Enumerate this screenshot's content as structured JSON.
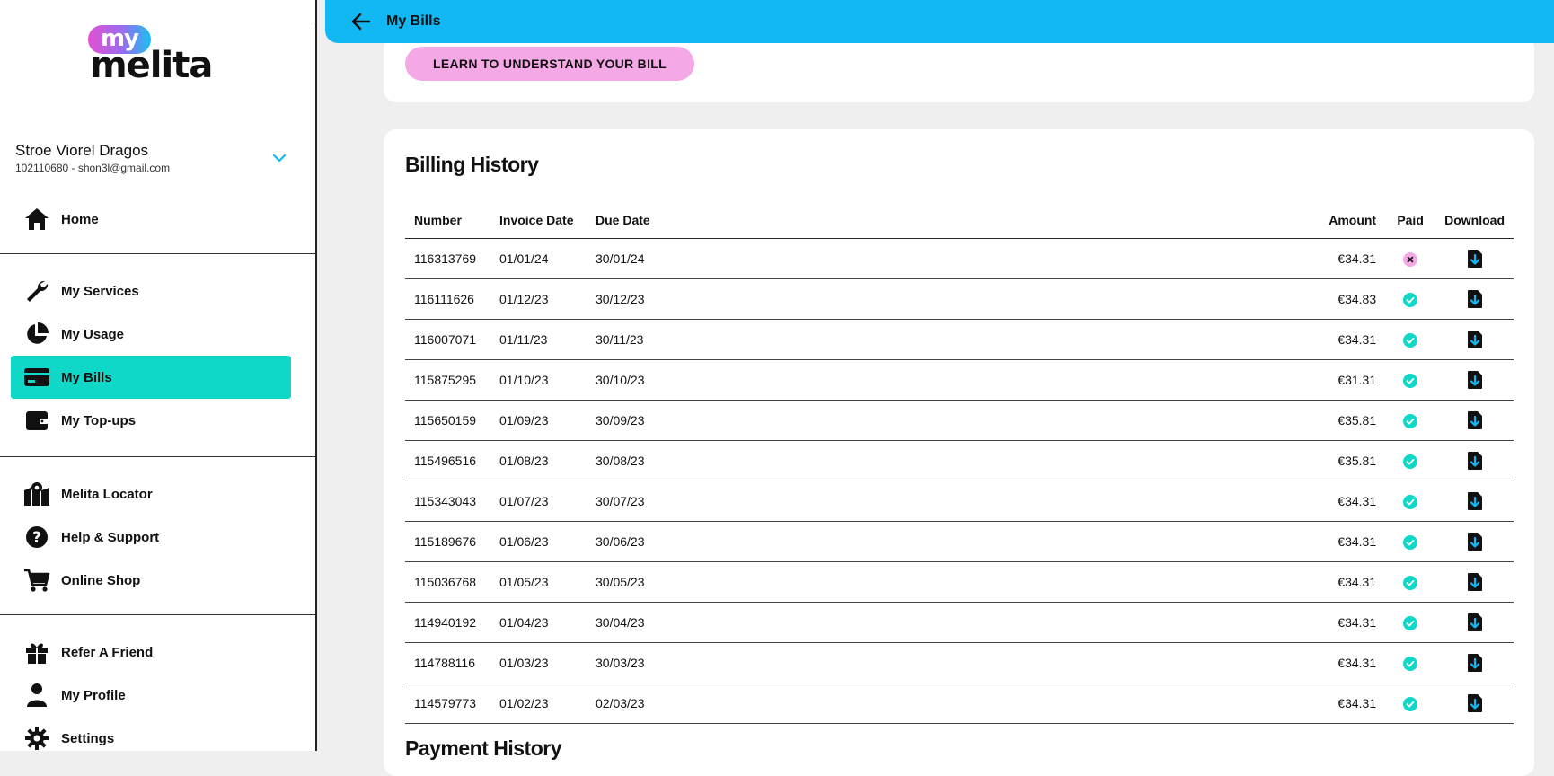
{
  "header": {
    "title": "My Bills"
  },
  "learn_button": "LEARN TO UNDERSTAND YOUR BILL",
  "logo": {
    "my": "my",
    "brand": "melita"
  },
  "user": {
    "name": "Stroe Viorel Dragos",
    "account": "102110680 - shon3l@gmail.com"
  },
  "sidebar": {
    "items": [
      {
        "label": "Home",
        "icon": "home-icon"
      },
      {
        "label": "My Services",
        "icon": "wrench-icon"
      },
      {
        "label": "My Usage",
        "icon": "pie-chart-icon"
      },
      {
        "label": "My Bills",
        "icon": "credit-card-icon",
        "active": true
      },
      {
        "label": "My Top-ups",
        "icon": "wallet-icon"
      },
      {
        "label": "Melita Locator",
        "icon": "map-pin-icon"
      },
      {
        "label": "Help & Support",
        "icon": "question-icon"
      },
      {
        "label": "Online Shop",
        "icon": "cart-icon"
      },
      {
        "label": "Refer A Friend",
        "icon": "gift-icon"
      },
      {
        "label": "My Profile",
        "icon": "user-icon"
      },
      {
        "label": "Settings",
        "icon": "gear-icon"
      }
    ]
  },
  "billing": {
    "title": "Billing History",
    "columns": {
      "number": "Number",
      "invoice": "Invoice Date",
      "due": "Due Date",
      "amount": "Amount",
      "paid": "Paid",
      "download": "Download"
    },
    "rows": [
      {
        "number": "116313769",
        "invoice": "01/01/24",
        "due": "30/01/24",
        "amount": "€34.31",
        "paid": false
      },
      {
        "number": "116111626",
        "invoice": "01/12/23",
        "due": "30/12/23",
        "amount": "€34.83",
        "paid": true
      },
      {
        "number": "116007071",
        "invoice": "01/11/23",
        "due": "30/11/23",
        "amount": "€34.31",
        "paid": true
      },
      {
        "number": "115875295",
        "invoice": "01/10/23",
        "due": "30/10/23",
        "amount": "€31.31",
        "paid": true
      },
      {
        "number": "115650159",
        "invoice": "01/09/23",
        "due": "30/09/23",
        "amount": "€35.81",
        "paid": true
      },
      {
        "number": "115496516",
        "invoice": "01/08/23",
        "due": "30/08/23",
        "amount": "€35.81",
        "paid": true
      },
      {
        "number": "115343043",
        "invoice": "01/07/23",
        "due": "30/07/23",
        "amount": "€34.31",
        "paid": true
      },
      {
        "number": "115189676",
        "invoice": "01/06/23",
        "due": "30/06/23",
        "amount": "€34.31",
        "paid": true
      },
      {
        "number": "115036768",
        "invoice": "01/05/23",
        "due": "30/05/23",
        "amount": "€34.31",
        "paid": true
      },
      {
        "number": "114940192",
        "invoice": "01/04/23",
        "due": "30/04/23",
        "amount": "€34.31",
        "paid": true
      },
      {
        "number": "114788116",
        "invoice": "01/03/23",
        "due": "30/03/23",
        "amount": "€34.31",
        "paid": true
      },
      {
        "number": "114579773",
        "invoice": "01/02/23",
        "due": "02/03/23",
        "amount": "€34.31",
        "paid": true
      }
    ]
  },
  "payment": {
    "title": "Payment History"
  },
  "colors": {
    "accent": "#12b8f4",
    "active": "#0fd8c8",
    "pink": "#f5a8e6"
  }
}
